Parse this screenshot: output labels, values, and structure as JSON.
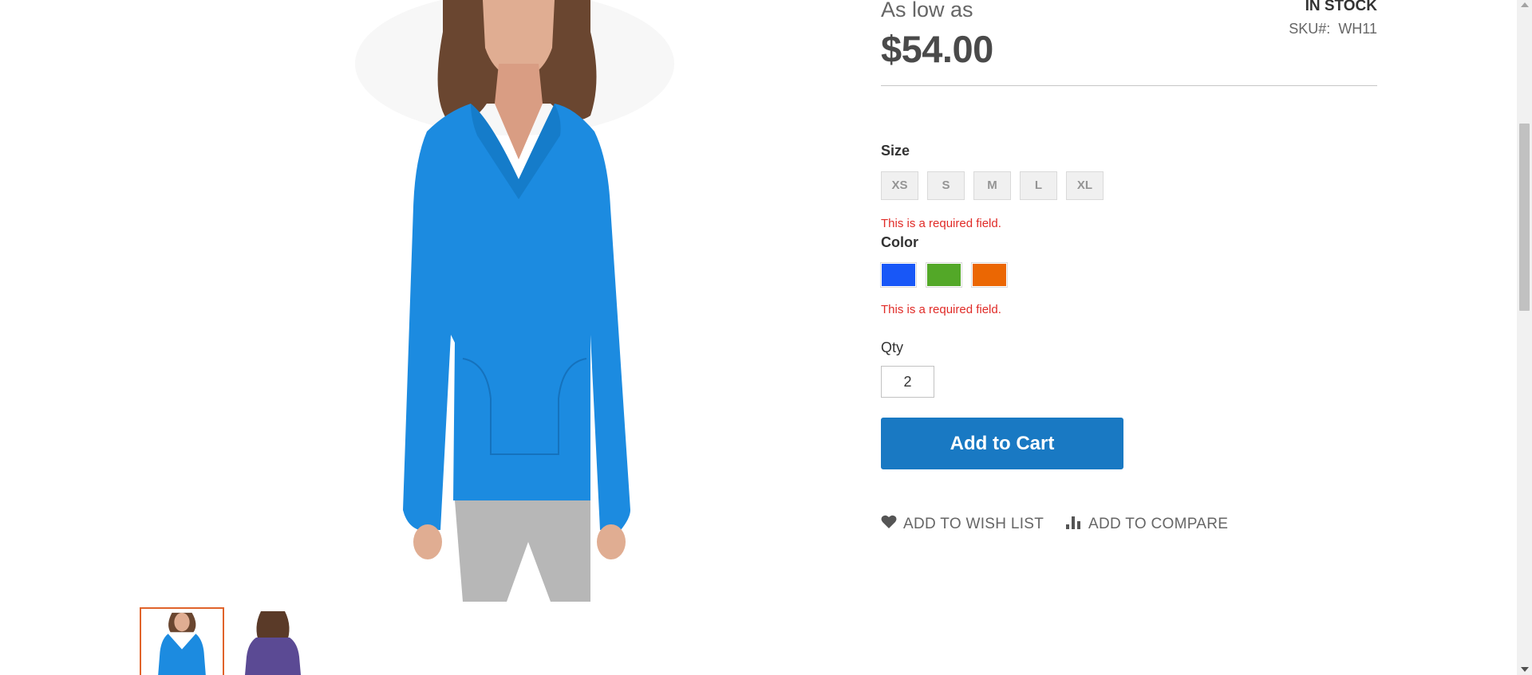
{
  "product": {
    "price_label": "As low as",
    "price": "$54.00",
    "stock_status": "In stock",
    "sku_label": "SKU#:",
    "sku_value": "WH11"
  },
  "gallery": {
    "main_image": "product-image-blue-hoodie",
    "thumbnails": [
      {
        "name": "blue hoodie front",
        "active": true
      },
      {
        "name": "purple hoodie back",
        "active": false
      }
    ]
  },
  "options": {
    "size": {
      "label": "Size",
      "values": [
        "XS",
        "S",
        "M",
        "L",
        "XL"
      ],
      "error": "This is a required field."
    },
    "color": {
      "label": "Color",
      "swatches": [
        "#1857f7",
        "#53a828",
        "#eb6703"
      ],
      "error": "This is a required field."
    }
  },
  "qty": {
    "label": "Qty",
    "value": "2"
  },
  "actions": {
    "add_to_cart": "Add to Cart",
    "wish_list": "Add to Wish List",
    "compare": "Add to Compare"
  },
  "colors": {
    "primary_button": "#1979c3",
    "error": "#e02b27",
    "thumb_active_border": "#e0632a"
  }
}
